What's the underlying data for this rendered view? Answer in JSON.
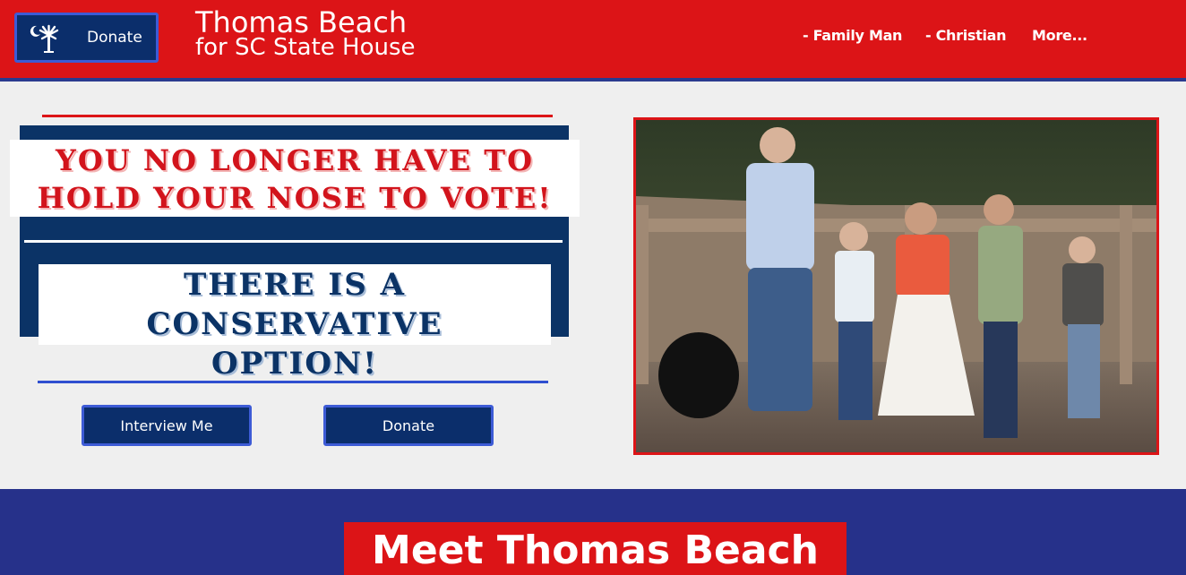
{
  "header": {
    "donate_label": "Donate",
    "title_line1": "Thomas Beach",
    "title_line2": "for SC State House",
    "nav": [
      {
        "label": "- Family Man"
      },
      {
        "label": "- Christian"
      },
      {
        "label": "More..."
      }
    ]
  },
  "hero": {
    "headline_line1": "YOU NO LONGER HAVE TO",
    "headline_line2": "HOLD YOUR NOSE TO VOTE!",
    "sub_line1": "THERE IS A CONSERVATIVE",
    "sub_line2": "OPTION!",
    "buttons": {
      "interview": "Interview Me",
      "donate": "Donate"
    }
  },
  "section": {
    "heading": "Meet Thomas Beach"
  },
  "colors": {
    "red": "#dc1417",
    "navy": "#0b3366",
    "band": "#26318a",
    "button_border": "#3d5bd6"
  },
  "icons": {
    "flag": "palmetto-flag-icon"
  }
}
